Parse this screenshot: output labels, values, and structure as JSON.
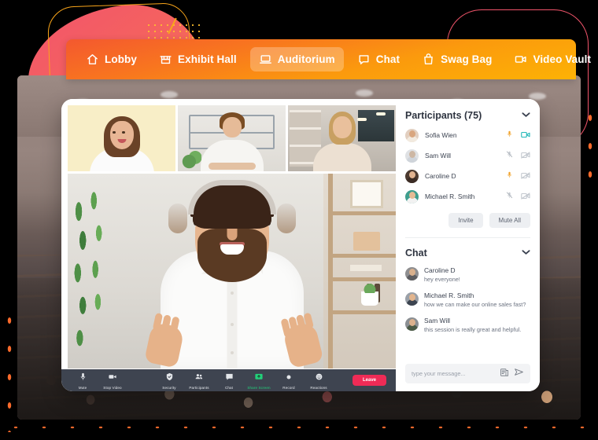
{
  "nav": {
    "items": [
      {
        "label": "Lobby",
        "icon": "home-icon",
        "active": false
      },
      {
        "label": "Exhibit Hall",
        "icon": "store-icon",
        "active": false
      },
      {
        "label": "Auditorium",
        "icon": "laptop-icon",
        "active": true
      },
      {
        "label": "Chat",
        "icon": "chat-bubble-icon",
        "active": false
      },
      {
        "label": "Swag Bag",
        "icon": "shopping-bag-icon",
        "active": false
      },
      {
        "label": "Video Vault",
        "icon": "video-camera-icon",
        "active": false
      }
    ]
  },
  "participants": {
    "title": "Participants (75)",
    "collapse_icon": "chevron-down-icon",
    "rows": [
      {
        "name": "Sofia Wien",
        "mic": "on",
        "cam": "on"
      },
      {
        "name": "Sam Will",
        "mic": "off",
        "cam": "off"
      },
      {
        "name": "Caroline D",
        "mic": "on",
        "cam": "off"
      },
      {
        "name": "Michael R. Smith",
        "mic": "off",
        "cam": "off"
      }
    ],
    "invite_label": "Invite",
    "mute_all_label": "Mute All"
  },
  "chat": {
    "title": "Chat",
    "collapse_icon": "chevron-down-icon",
    "messages": [
      {
        "name": "Caroline D",
        "text": "hey everyone!"
      },
      {
        "name": "Michael R. Smith",
        "text": "how we can make our online sales fast?"
      },
      {
        "name": "Sam Will",
        "text": "this session is really great and helpful."
      }
    ],
    "composer": {
      "placeholder": "type your message...",
      "attach_icon": "document-icon",
      "send_icon": "send-icon"
    }
  },
  "toolbar": {
    "buttons": [
      {
        "label": "Mute",
        "icon": "microphone-icon",
        "highlight": false
      },
      {
        "label": "Stop Video",
        "icon": "video-camera-icon",
        "highlight": false
      },
      {
        "label": "Security",
        "icon": "shield-check-icon",
        "highlight": false
      },
      {
        "label": "Participants",
        "icon": "people-icon",
        "highlight": false
      },
      {
        "label": "Chat",
        "icon": "chat-bubble-icon",
        "highlight": false
      },
      {
        "label": "Share Screen",
        "icon": "share-screen-icon",
        "highlight": true
      },
      {
        "label": "Record",
        "icon": "record-dot-icon",
        "highlight": false
      },
      {
        "label": "Reactions",
        "icon": "smiley-icon",
        "highlight": false
      }
    ],
    "leave_label": "Leave"
  },
  "colors": {
    "nav_gradient_start": "#f4582f",
    "nav_gradient_end": "#fdb205",
    "leave_red": "#ef2b56",
    "share_green": "#22d07a",
    "mic_on_orange": "#f0a22a",
    "cam_on_teal": "#21b7b7",
    "icon_off_gray": "#b9bec6",
    "toolbar_bg": "#3e4450",
    "accent_pink": "#f2556b",
    "accent_orange_dot": "#f96a2b"
  }
}
